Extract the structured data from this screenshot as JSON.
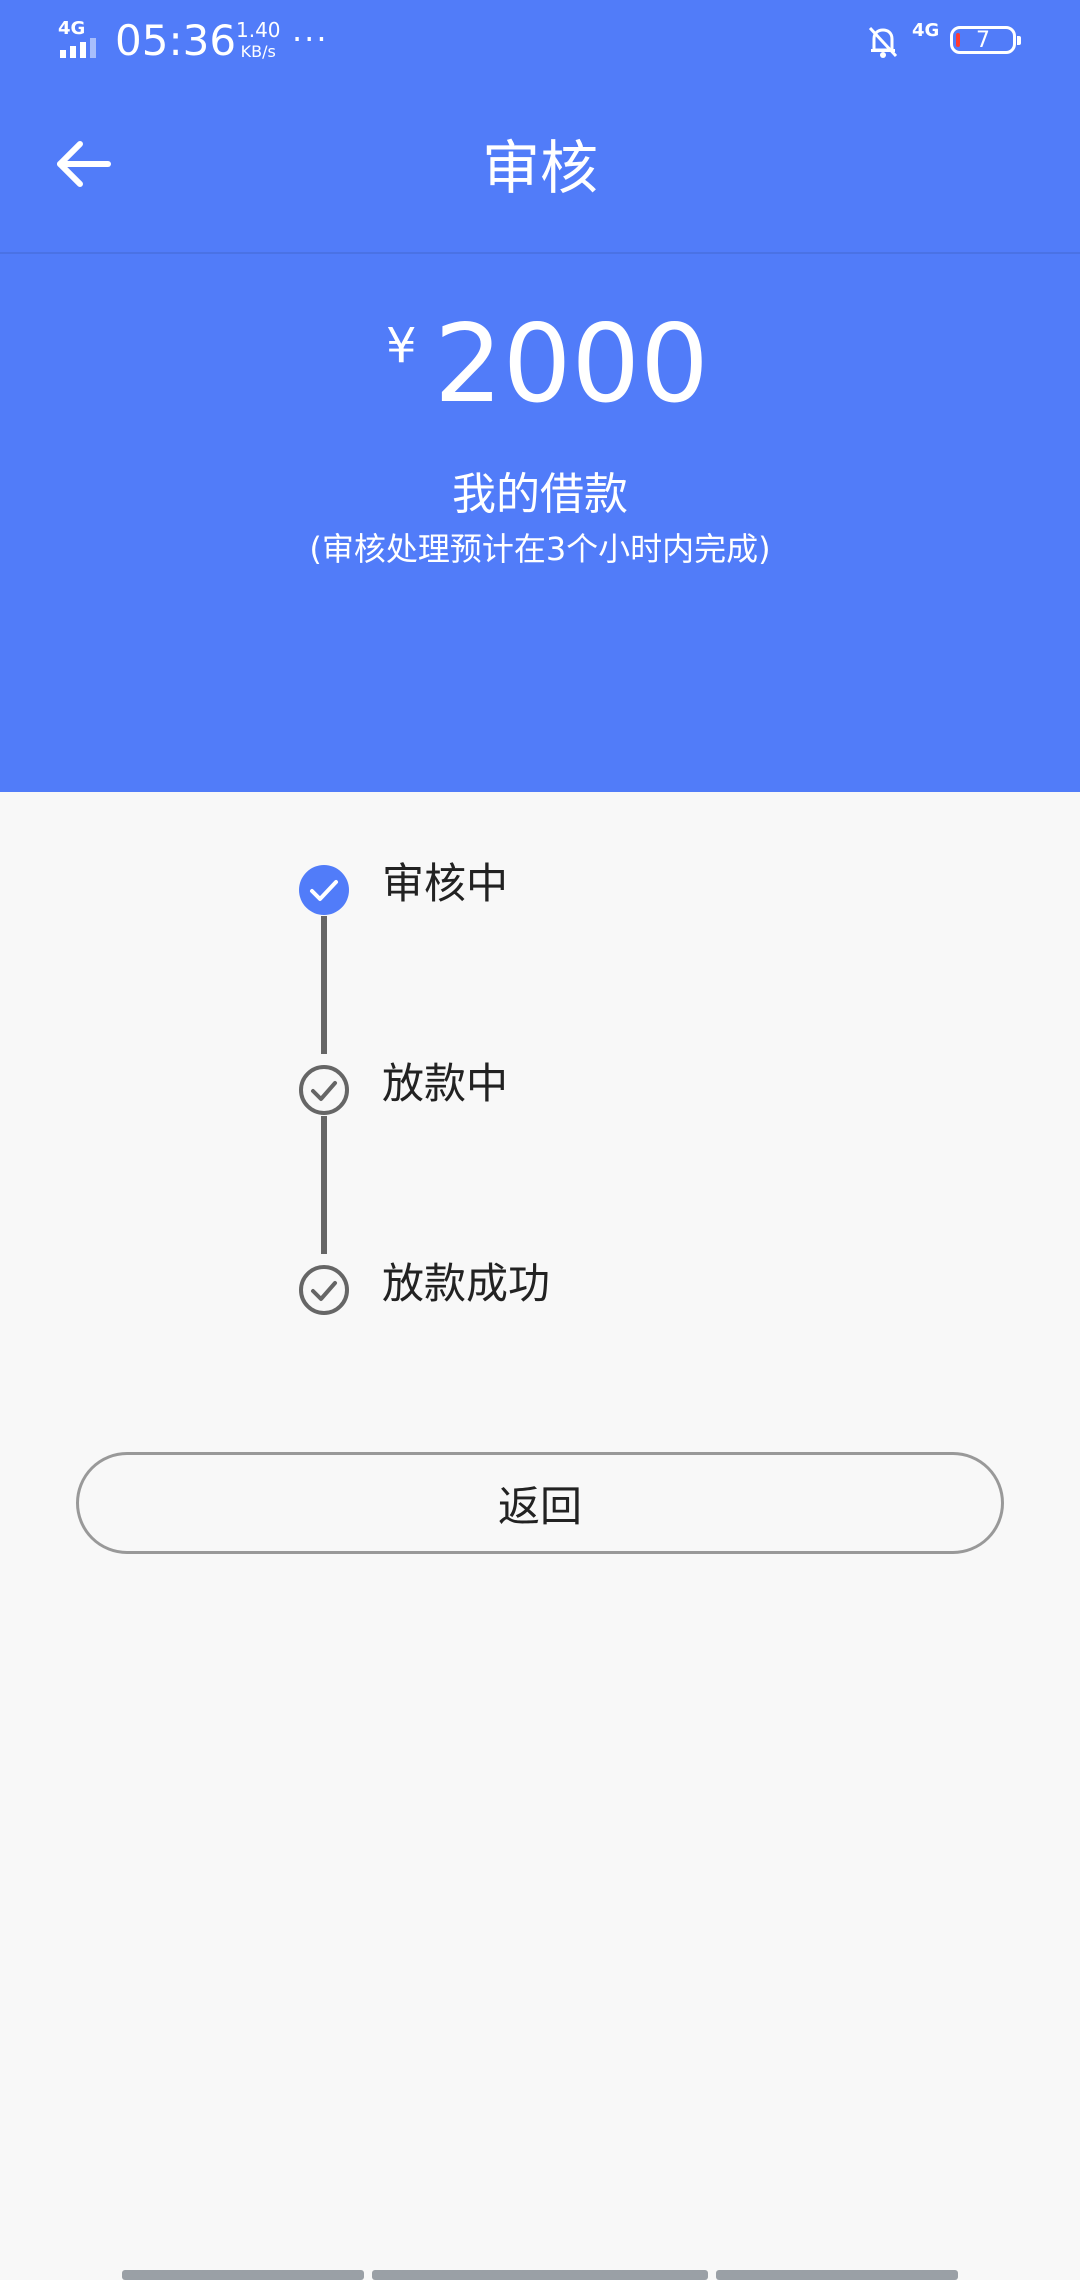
{
  "status_bar": {
    "network": "4G",
    "time": "05:36",
    "speed_value": "1.40",
    "speed_unit": "KB/s",
    "more": "···",
    "network2": "4G",
    "battery": "7"
  },
  "header": {
    "title": "审核"
  },
  "loan": {
    "currency": "¥",
    "amount": "2000",
    "label": "我的借款",
    "note": "(审核处理预计在3个小时内完成)"
  },
  "steps": [
    {
      "label": "审核中",
      "active": true
    },
    {
      "label": "放款中",
      "active": false
    },
    {
      "label": "放款成功",
      "active": false
    }
  ],
  "actions": {
    "back_label": "返回"
  },
  "colors": {
    "primary": "#517cf9",
    "inactive": "#666666",
    "background": "#f8f8f8"
  }
}
